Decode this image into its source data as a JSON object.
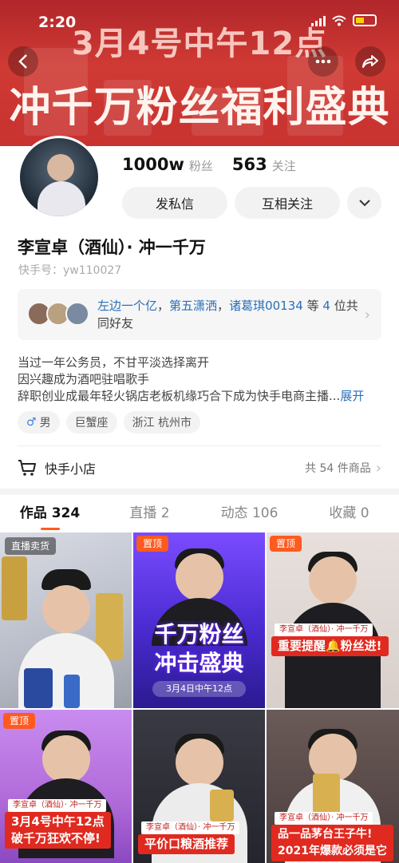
{
  "status_bar": {
    "time": "2:20"
  },
  "banner": {
    "line1": "3月4号中午12点",
    "line2": "冲千万粉丝福利盛典"
  },
  "profile": {
    "followers_count": "1000w",
    "followers_label": "粉丝",
    "following_count": "563",
    "following_label": "关注",
    "message_button": "发私信",
    "mutual_follow_button": "互相关注",
    "name": "李宣卓（酒仙）· 冲一千万",
    "kuaishou_id": "快手号：yw110027"
  },
  "common_friends": {
    "names": [
      "左边一个亿",
      "第五潇洒",
      "诸葛琪00134"
    ],
    "sep": "，",
    "prefix": "等",
    "count": "4",
    "suffix": "位共同好友"
  },
  "bio": {
    "lines": [
      "当过一年公务员，不甘平淡选择离开",
      "因兴趣成为酒吧驻唱歌手",
      "辞职创业成最年轻火锅店老板机缘巧合下成为快手电商主播..."
    ],
    "expand_label": "展开"
  },
  "tags": [
    "男",
    "巨蟹座",
    "浙江 杭州市"
  ],
  "shop": {
    "label": "快手小店",
    "count_text": "共 54 件商品"
  },
  "tabs": [
    {
      "label": "作品 324"
    },
    {
      "label": "直播 2"
    },
    {
      "label": "动态 106"
    },
    {
      "label": "收藏 0"
    }
  ],
  "videos": [
    {
      "badge": "直播卖货"
    },
    {
      "badge": "置顶",
      "title1": "千万粉丝",
      "title2": "冲击盛典",
      "date": "3月4日中午12点"
    },
    {
      "badge": "置顶",
      "label_small": "李宣卓（酒仙）· 冲一千万",
      "label_big": "重要提醒🔔粉丝进!"
    },
    {
      "badge": "置顶",
      "label_small": "李宣卓（酒仙）· 冲一千万",
      "label_big1": "3月4号中午12点",
      "label_big2": "破千万狂欢不停!"
    },
    {
      "label_small": "李宣卓（酒仙）· 冲一千万",
      "label_big": "平价口粮酒推荐"
    },
    {
      "label_small": "李宣卓（酒仙）· 冲一千万",
      "label_big1": "品一品茅台王子牛!",
      "label_big2": "2021年爆款必须是它"
    }
  ],
  "colors": {
    "accent": "#ff5a1f",
    "link": "#2a6fb9",
    "banner": "#c8322f"
  }
}
